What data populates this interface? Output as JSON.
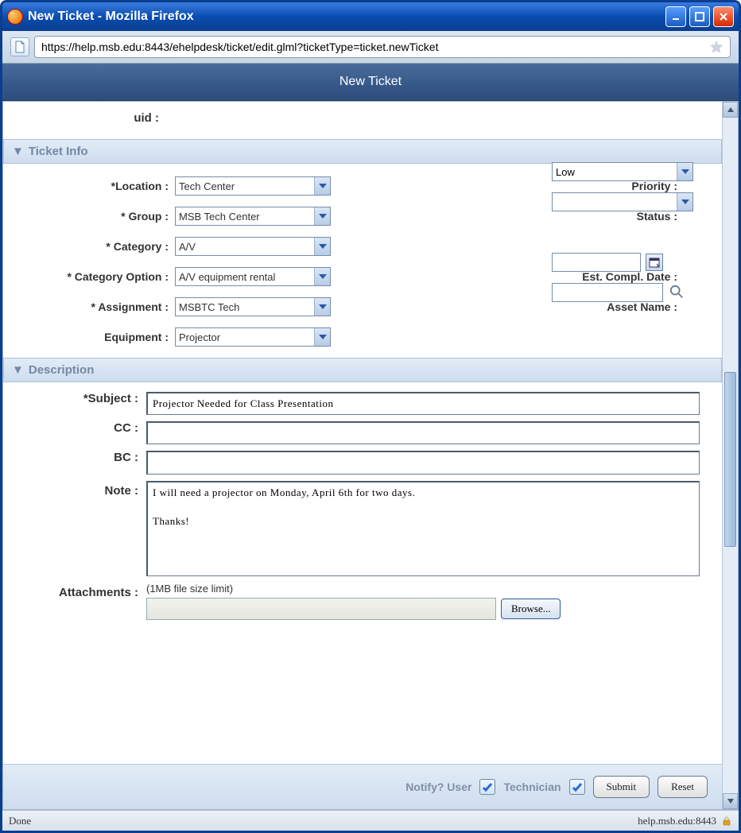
{
  "window": {
    "title": "New Ticket - Mozilla Firefox",
    "url": "https://help.msb.edu:8443/ehelpdesk/ticket/edit.glml?ticketType=ticket.newTicket"
  },
  "app": {
    "header_title": "New Ticket"
  },
  "uid": {
    "label": "uid :"
  },
  "sections": {
    "ticket_info": "Ticket Info",
    "description": "Description"
  },
  "labels": {
    "location": "*Location :",
    "group": "* Group :",
    "category": "* Category :",
    "category_option": "* Category Option :",
    "assignment": "* Assignment :",
    "equipment": "Equipment :",
    "priority": "Priority :",
    "status": "Status :",
    "est_date": "Est. Compl. Date :",
    "asset_name": "Asset Name :",
    "subject": "*Subject :",
    "cc": "CC :",
    "bc": "BC :",
    "note": "Note :",
    "attachments": "Attachments :",
    "attach_hint": "(1MB file size limit)",
    "browse": "Browse..."
  },
  "values": {
    "location": "Tech Center",
    "group": "MSB Tech Center",
    "category": "A/V",
    "category_option": "A/V equipment rental",
    "assignment": "MSBTC Tech",
    "equipment": "Projector",
    "priority": "Low",
    "status": "",
    "est_date": "",
    "asset_name": "",
    "subject": "Projector Needed for Class Presentation",
    "cc": "",
    "bc": "",
    "note": "I will need a projector on Monday, April 6th for two days.\n\nThanks!"
  },
  "footer": {
    "notify": "Notify? User",
    "technician": "Technician",
    "submit": "Submit",
    "reset": "Reset"
  },
  "status_bar": {
    "left": "Done",
    "right": "help.msb.edu:8443"
  }
}
